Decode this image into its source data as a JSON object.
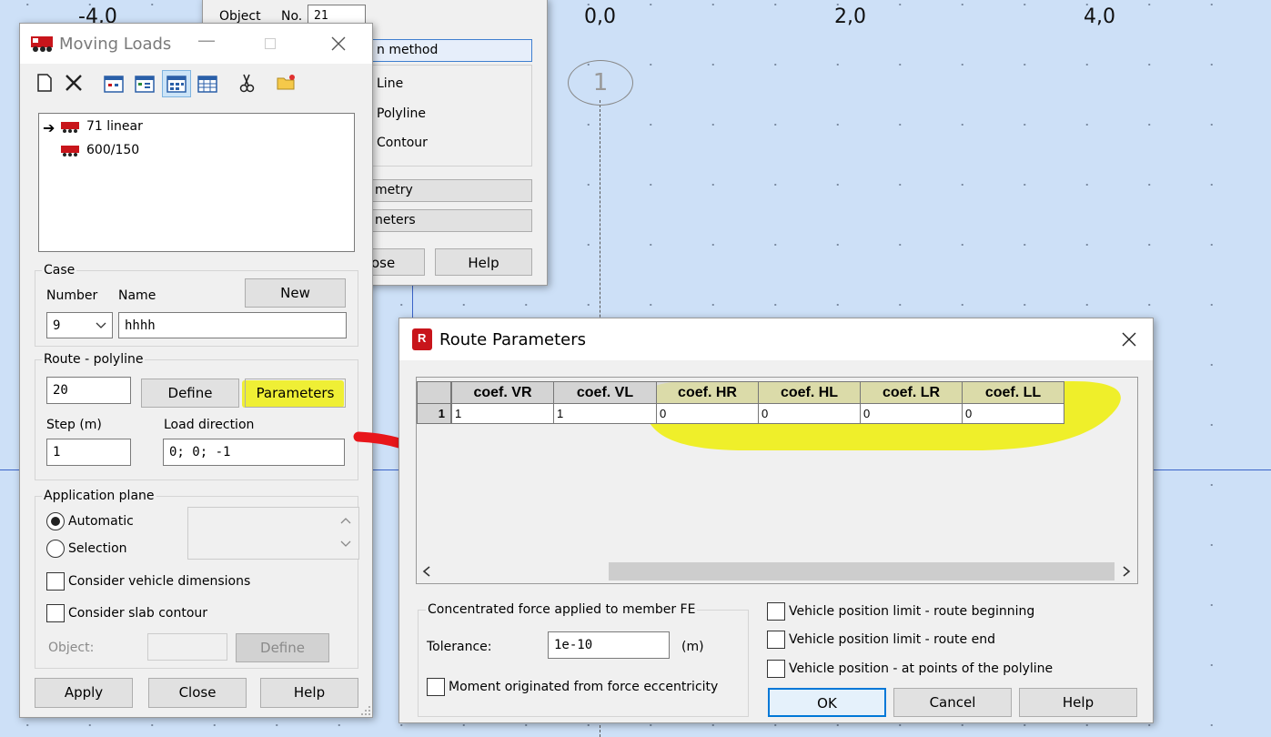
{
  "canvas": {
    "axis_labels": [
      "-4,0",
      "0,0",
      "2,0",
      "4,0"
    ],
    "node_label": "1"
  },
  "back_window": {
    "object_label": "Object",
    "no_label": "No.",
    "no_value": "21",
    "method_header": "n method",
    "options": [
      "Line",
      "Polyline",
      "Contour"
    ],
    "geometry_label": "metry",
    "parameters_label": "neters",
    "close_label": "ose",
    "help_label": "Help"
  },
  "moving_loads": {
    "title": "Moving Loads",
    "toolbar": [
      "new-icon",
      "delete-icon",
      "view1-icon",
      "view2-icon",
      "view3-icon",
      "table-icon",
      "cut-icon",
      "open-icon"
    ],
    "tree": [
      {
        "label": "71 linear",
        "active": true
      },
      {
        "label": "600/150",
        "active": false
      }
    ],
    "case": {
      "group_label": "Case",
      "number_label": "Number",
      "name_label": "Name",
      "new_label": "New",
      "number_value": "9",
      "name_value": "hhhh"
    },
    "route": {
      "group_label": "Route - polyline",
      "value": "20",
      "define_label": "Define",
      "parameters_label": "Parameters",
      "step_label": "Step (m)",
      "step_value": "1",
      "load_dir_label": "Load direction",
      "load_dir_value": "0; 0; -1"
    },
    "application_plane": {
      "group_label": "Application plane",
      "automatic_label": "Automatic",
      "selection_label": "Selection",
      "selected": "automatic",
      "consider_vehicle_label": "Consider vehicle dimensions",
      "consider_slab_label": "Consider slab contour",
      "object_label": "Object:",
      "define_label": "Define"
    },
    "buttons": {
      "apply": "Apply",
      "close": "Close",
      "help": "Help"
    }
  },
  "route_parameters": {
    "title": "Route Parameters",
    "columns": [
      "coef. VR",
      "coef. VL",
      "coef. HR",
      "coef. HL",
      "coef. LR",
      "coef. LL"
    ],
    "rows": [
      {
        "index": "1",
        "values": [
          "1",
          "1",
          "0",
          "0",
          "0",
          "0"
        ]
      }
    ],
    "concentrated": {
      "group_label": "Concentrated force applied to member  FE",
      "tolerance_label": "Tolerance:",
      "tolerance_value": "1e-10",
      "tolerance_unit": "(m)",
      "moment_label": "Moment originated from force eccentricity"
    },
    "checkboxes": [
      "Vehicle position limit - route beginning",
      "Vehicle position limit - route end",
      "Vehicle position - at points of the polyline"
    ],
    "buttons": {
      "ok": "OK",
      "cancel": "Cancel",
      "help": "Help"
    }
  },
  "colors": {
    "highlight": "#eeee14",
    "arrow": "#e8161b",
    "canvas_bg": "#cde0f7"
  }
}
